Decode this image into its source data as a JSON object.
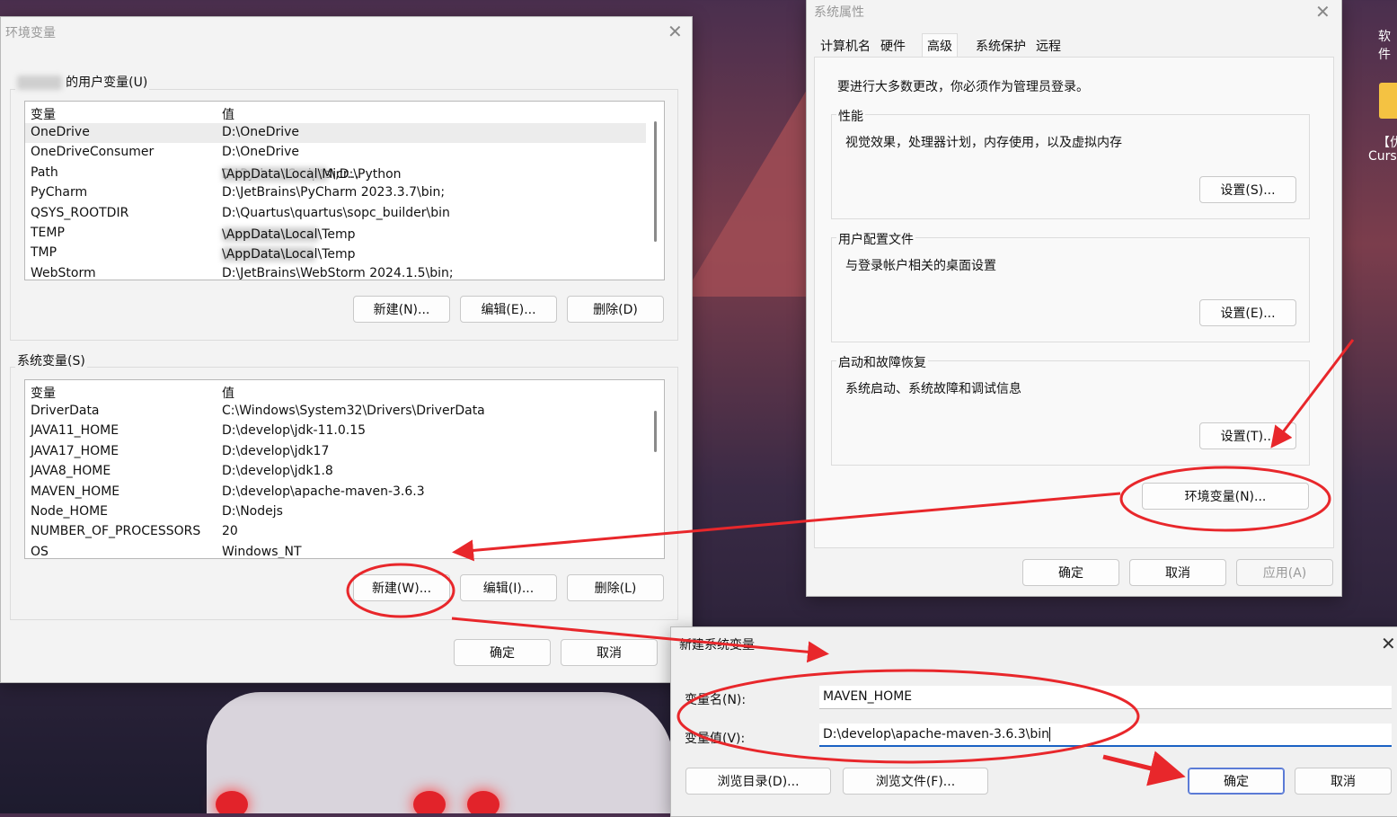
{
  "env_window": {
    "title": "环境变量",
    "user_group_label": "的用户变量(U)",
    "user_columns": [
      "变量",
      "值"
    ],
    "user_vars": [
      {
        "name": "OneDrive",
        "value": "D:\\OneDrive"
      },
      {
        "name": "OneDriveConsumer",
        "value": "D:\\OneDrive"
      },
      {
        "name": "Path",
        "value_prefix": "D:\\Python\\Scripts\\;D:\\Python",
        "value_suffix": "\\AppData\\Local\\Micr..."
      },
      {
        "name": "PyCharm",
        "value": "D:\\JetBrains\\PyCharm 2023.3.7\\bin;"
      },
      {
        "name": "QSYS_ROOTDIR",
        "value": "D:\\Quartus\\quartus\\sopc_builder\\bin"
      },
      {
        "name": "TEMP",
        "value_suffix": "\\AppData\\Local\\Temp"
      },
      {
        "name": "TMP",
        "value_suffix": "\\AppData\\Local\\Temp"
      },
      {
        "name": "WebStorm",
        "value": "D:\\JetBrains\\WebStorm 2024.1.5\\bin;"
      }
    ],
    "user_buttons": {
      "new": "新建(N)...",
      "edit": "编辑(E)...",
      "delete": "删除(D)"
    },
    "system_group_label": "系统变量(S)",
    "system_columns": [
      "变量",
      "值"
    ],
    "system_vars": [
      {
        "name": "DriverData",
        "value": "C:\\Windows\\System32\\Drivers\\DriverData"
      },
      {
        "name": "JAVA11_HOME",
        "value": "D:\\develop\\jdk-11.0.15"
      },
      {
        "name": "JAVA17_HOME",
        "value": "D:\\develop\\jdk17"
      },
      {
        "name": "JAVA8_HOME",
        "value": "D:\\develop\\jdk1.8"
      },
      {
        "name": "MAVEN_HOME",
        "value": "D:\\develop\\apache-maven-3.6.3"
      },
      {
        "name": "Node_HOME",
        "value": "D:\\Nodejs"
      },
      {
        "name": "NUMBER_OF_PROCESSORS",
        "value": "20"
      },
      {
        "name": "OS",
        "value": "Windows_NT"
      }
    ],
    "system_buttons": {
      "new": "新建(W)...",
      "edit": "编辑(I)...",
      "delete": "删除(L)"
    },
    "ok": "确定",
    "cancel": "取消"
  },
  "sys_props": {
    "title": "系统属性",
    "tabs": [
      "计算机名",
      "硬件",
      "高级",
      "系统保护",
      "远程"
    ],
    "active_tab": "高级",
    "admin_note": "要进行大多数更改，你必须作为管理员登录。",
    "performance": {
      "label": "性能",
      "desc": "视觉效果，处理器计划，内存使用，以及虚拟内存",
      "button": "设置(S)..."
    },
    "profiles": {
      "label": "用户配置文件",
      "desc": "与登录帐户相关的桌面设置",
      "button": "设置(E)..."
    },
    "startup": {
      "label": "启动和故障恢复",
      "desc": "系统启动、系统故障和调试信息",
      "button": "设置(T)..."
    },
    "env_button": "环境变量(N)...",
    "ok": "确定",
    "cancel": "取消",
    "apply": "应用(A)"
  },
  "new_var_dialog": {
    "title": "新建系统变量",
    "name_label": "变量名(N):",
    "name_value": "MAVEN_HOME",
    "value_label": "变量值(V):",
    "value_value": "D:\\develop\\apache-maven-3.6.3\\bin",
    "browse_dir": "浏览目录(D)...",
    "browse_file": "浏览文件(F)...",
    "ok": "确定",
    "cancel": "取消"
  },
  "desktop": {
    "label_top": "软件",
    "label_bracket": "【优",
    "label_curs": "Curs"
  },
  "annotations": {
    "color": "#e8272b"
  }
}
